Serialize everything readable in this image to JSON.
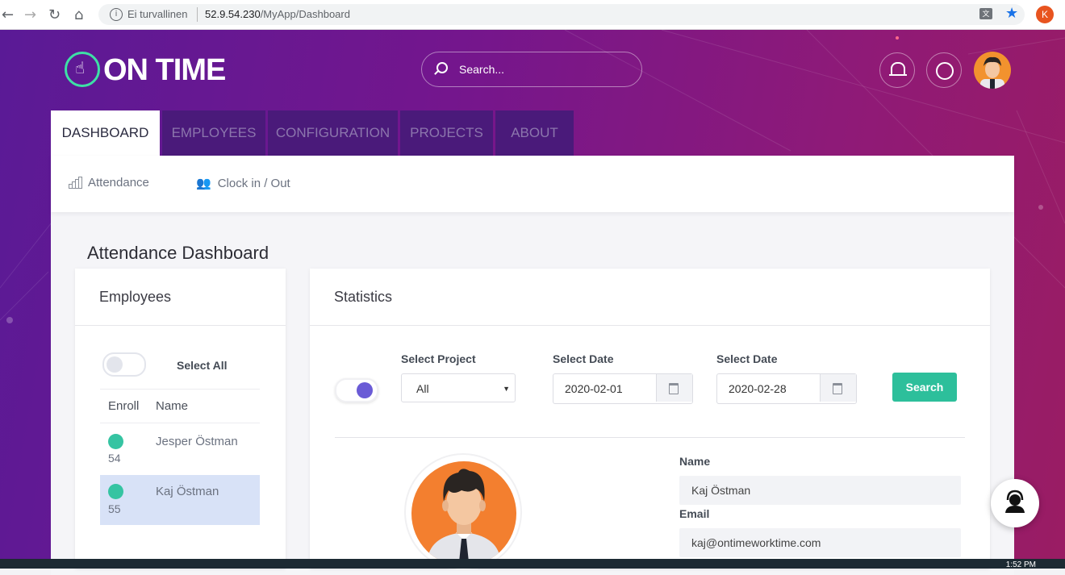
{
  "browser": {
    "security_label": "Ei turvallinen",
    "url_host": "52.9.54.230",
    "url_path": "/MyApp/Dashboard",
    "profile_initial": "K"
  },
  "app": {
    "logo_text": "ON TIME",
    "search_placeholder": "Search..."
  },
  "tabs": [
    {
      "label": "DASHBOARD",
      "active": true
    },
    {
      "label": "EMPLOYEES"
    },
    {
      "label": "CONFIGURATION"
    },
    {
      "label": "PROJECTS"
    },
    {
      "label": "ABOUT"
    }
  ],
  "subnav": {
    "attendance": "Attendance",
    "clock": "Clock in / Out"
  },
  "page_title": "Attendance Dashboard",
  "employees_panel": {
    "title": "Employees",
    "select_all": "Select All",
    "col_enroll": "Enroll",
    "col_name": "Name",
    "rows": [
      {
        "enroll": "54",
        "name": "Jesper Östman",
        "selected": false
      },
      {
        "enroll": "55",
        "name": "Kaj Östman",
        "selected": true
      }
    ]
  },
  "statistics": {
    "title": "Statistics",
    "project_label": "Select Project",
    "project_value": "All",
    "date_from_label": "Select Date",
    "date_from": "2020-02-01",
    "date_to_label": "Select Date",
    "date_to": "2020-02-28",
    "search_button": "Search",
    "name_label": "Name",
    "name_value": "Kaj Östman",
    "email_label": "Email",
    "email_value": "kaj@ontimeworktime.com"
  },
  "taskbar": {
    "clock": "1:52 PM"
  },
  "colors": {
    "accent_green": "#2dbf9b",
    "toggle_on": "#6a5bd6",
    "brand_gradient_start": "#5a1a96"
  }
}
